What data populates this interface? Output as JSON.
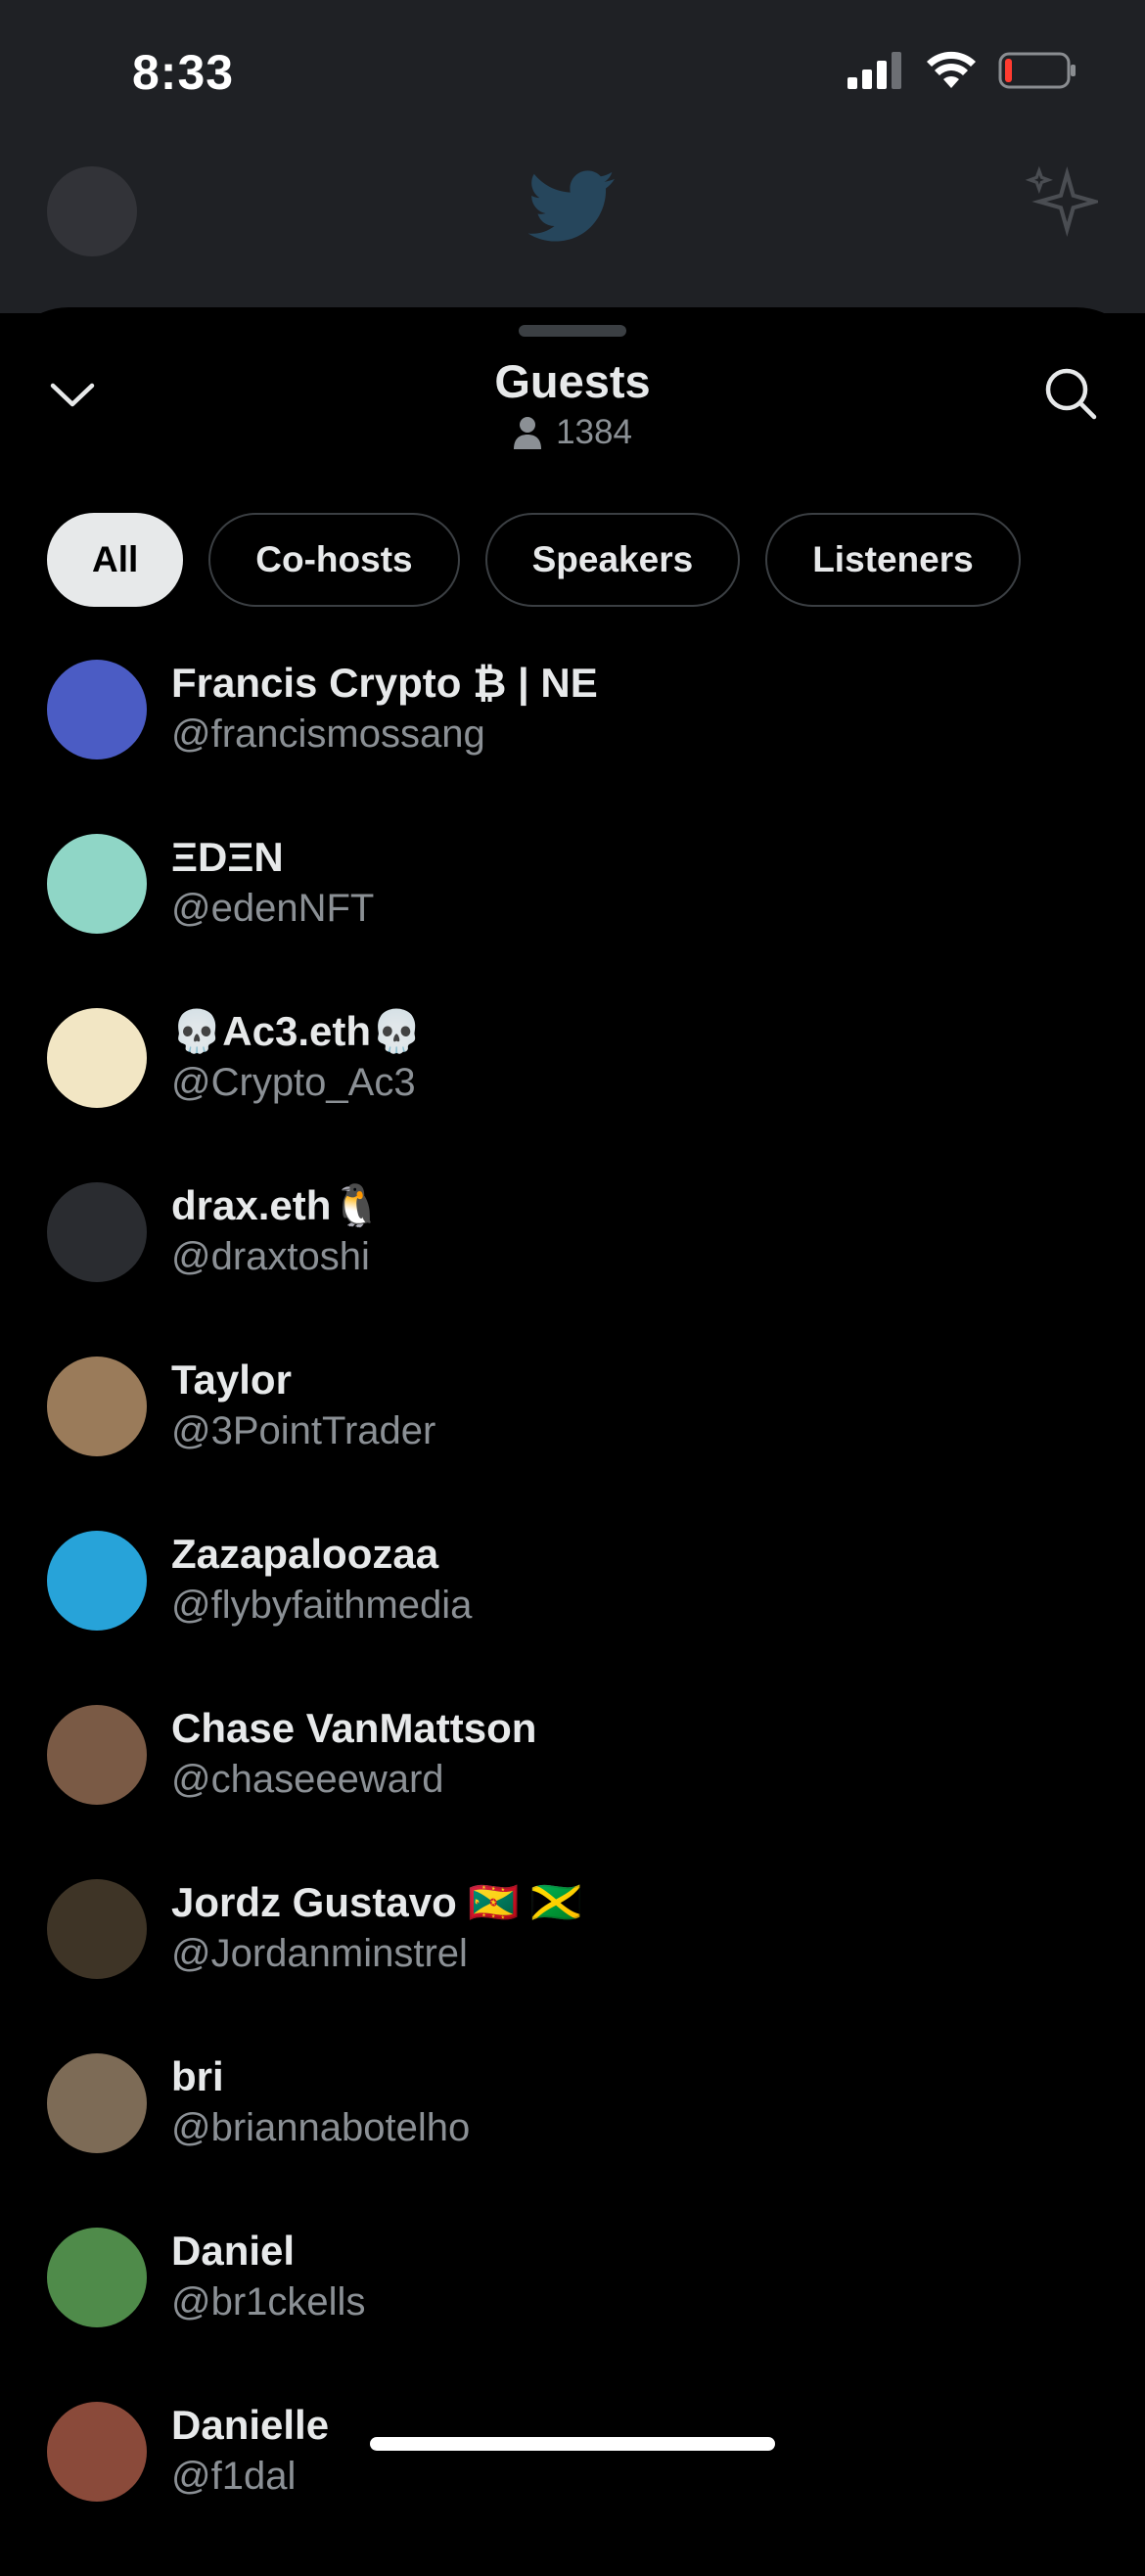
{
  "status": {
    "time": "8:33"
  },
  "sheet": {
    "title": "Guests",
    "listener_count": "1384"
  },
  "tabs": [
    {
      "label": "All",
      "active": true
    },
    {
      "label": "Co-hosts",
      "active": false
    },
    {
      "label": "Speakers",
      "active": false
    },
    {
      "label": "Listeners",
      "active": false
    }
  ],
  "guests": [
    {
      "name": "Francis Crypto ₿ | NE",
      "handle": "@francismossang",
      "avatar_color": "#4b5cc4"
    },
    {
      "name": "ΞDΞN",
      "handle": "@edenNFT",
      "avatar_color": "#8fd6c6"
    },
    {
      "name": "💀Ac3.eth💀",
      "handle": "@Crypto_Ac3",
      "avatar_color": "#f2e6c4"
    },
    {
      "name": "drax.eth🐧",
      "handle": "@draxtoshi",
      "avatar_color": "#2a2c30"
    },
    {
      "name": "Taylor",
      "handle": "@3PointTrader",
      "avatar_color": "#9a7b5a"
    },
    {
      "name": "Zazapaloozaa",
      "handle": "@flybyfaithmedia",
      "avatar_color": "#27a3d9"
    },
    {
      "name": "Chase VanMattson",
      "handle": "@chaseeeward",
      "avatar_color": "#7a5a45"
    },
    {
      "name": "Jordz Gustavo 🇬🇩 🇯🇲",
      "handle": "@Jordanminstrel",
      "avatar_color": "#3e3426"
    },
    {
      "name": "bri",
      "handle": "@briannabotelho",
      "avatar_color": "#7d6b56"
    },
    {
      "name": "Daniel",
      "handle": "@br1ckells",
      "avatar_color": "#4f8b4a"
    },
    {
      "name": "Danielle",
      "handle": "@f1dal",
      "avatar_color": "#8a4a3a"
    }
  ],
  "colors": {
    "background": "#000000",
    "backdrop": "#1f2125",
    "text_primary": "#e7e9ea",
    "text_secondary": "#8b9095",
    "border": "#3b3f43"
  }
}
